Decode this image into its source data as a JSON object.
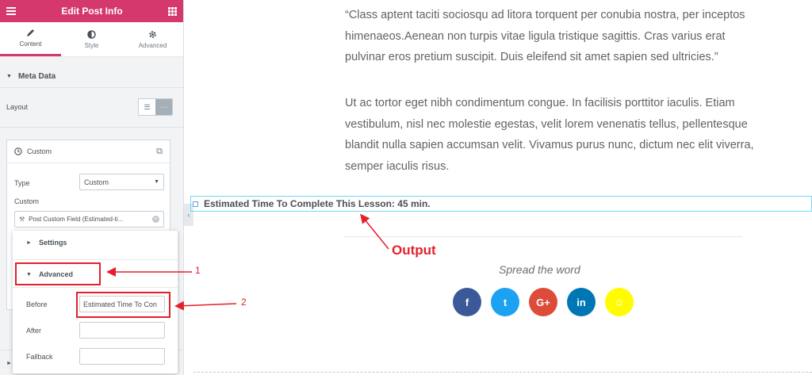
{
  "editor": {
    "title": "Edit Post Info",
    "tabs": [
      {
        "label": "Content",
        "icon": "pencil-icon"
      },
      {
        "label": "Style",
        "icon": "half-circle-icon"
      },
      {
        "label": "Advanced",
        "icon": "gear-icon"
      }
    ],
    "section_title": "Meta Data",
    "layout_label": "Layout",
    "layout_options": [
      "list-icon",
      "inline-icon"
    ],
    "layout_selected": "inline-icon",
    "item": {
      "title": "Custom",
      "type_label": "Type",
      "type_value": "Custom",
      "custom_label": "Custom",
      "custom_field_value": "Post Custom Field (Estimated-ti..."
    },
    "popover": {
      "settings_label": "Settings",
      "advanced_label": "Advanced",
      "before_label": "Before",
      "before_value": "Estimated Time To Con",
      "after_label": "After",
      "after_value": "",
      "fallback_label": "Fallback",
      "fallback_value": ""
    }
  },
  "preview": {
    "paragraph1": "“Class aptent taciti sociosqu ad litora torquent per conubia nostra, per inceptos himenaeos.Aenean non turpis vitae ligula tristique sagittis. Cras varius erat pulvinar eros pretium suscipit. Duis eleifend sit amet sapien sed ultricies.”",
    "paragraph2": "Ut ac tortor eget nibh condimentum congue. In facilisis porttitor iaculis. Etiam vestibulum, nisl nec molestie egestas, velit lorem venenatis tellus, pellentesque blandit nulla sapien accumsan velit. Vivamus purus nunc, dictum nec elit viverra, semper iaculis risus.",
    "post_info_output": "Estimated Time To Complete This Lesson: 45 min.",
    "spread_title": "Spread the word",
    "socials": [
      {
        "name": "facebook",
        "glyph": "f",
        "color": "#3b5998"
      },
      {
        "name": "twitter",
        "glyph": "t",
        "color": "#1da1f2"
      },
      {
        "name": "google-plus",
        "glyph": "G+",
        "color": "#dd4b39"
      },
      {
        "name": "linkedin",
        "glyph": "in",
        "color": "#0077b5"
      },
      {
        "name": "snapchat",
        "glyph": "☺",
        "color": "#fffc00"
      }
    ]
  },
  "annotations": {
    "marker1": "1",
    "marker2": "2",
    "output_label": "Output",
    "color": "#e4202b"
  }
}
